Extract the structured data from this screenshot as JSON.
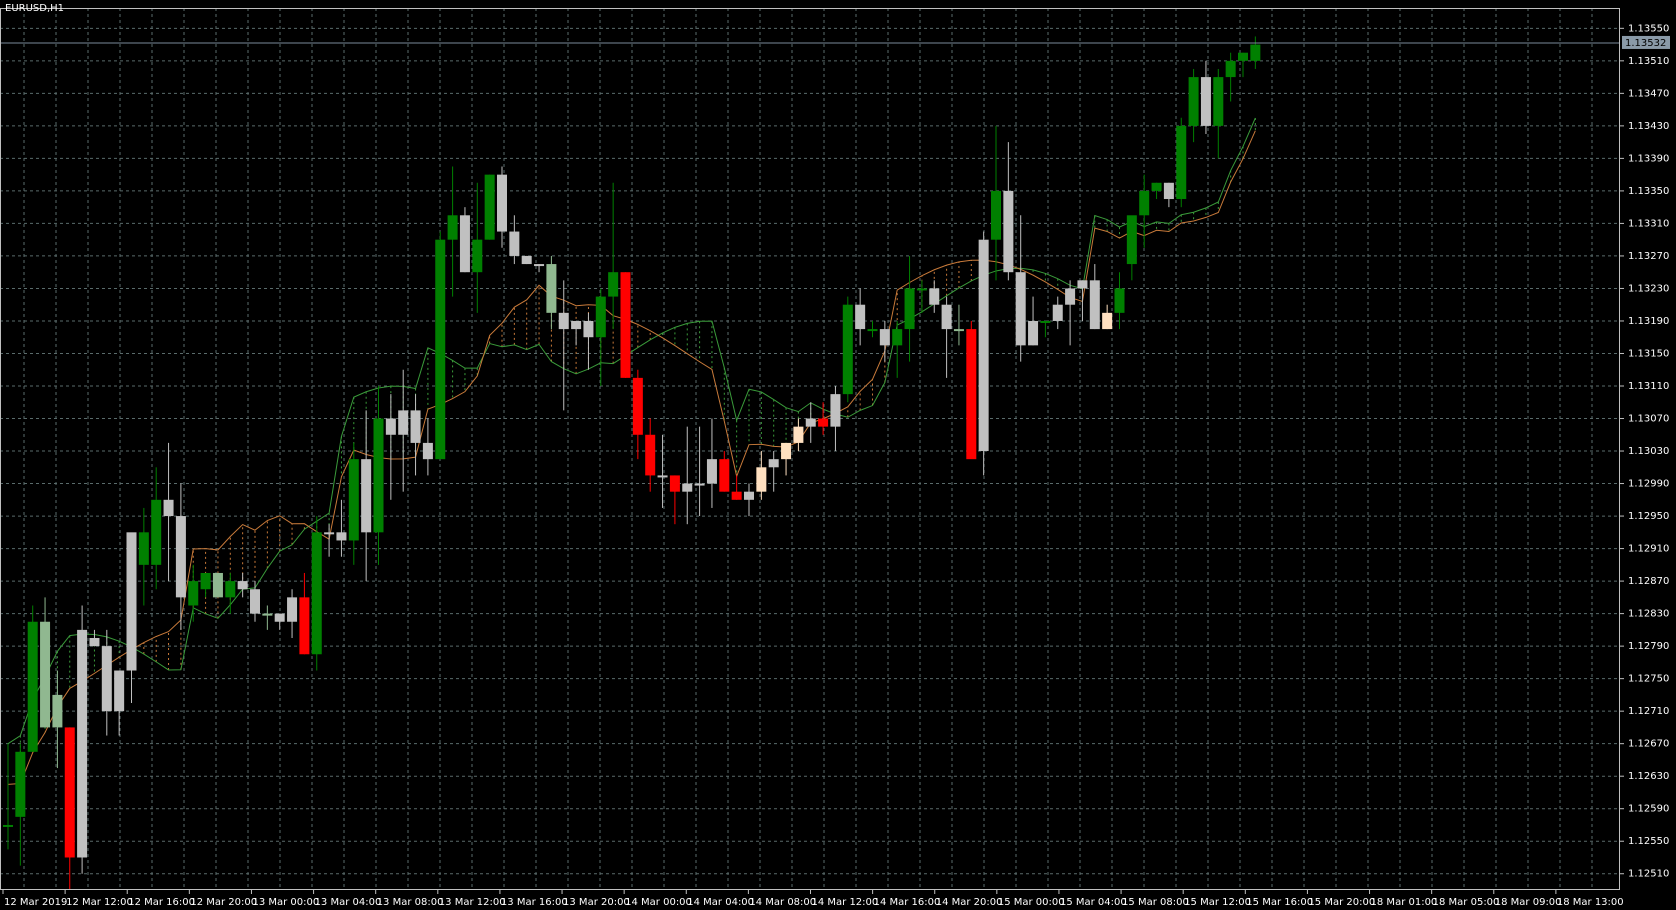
{
  "header": {
    "symbol": "EURUSD,H1"
  },
  "current_price_label": "1.13532",
  "colors": {
    "background": "#000000",
    "grid": "#5a6b6b",
    "axis": "#c0c0c0",
    "text": "#ffffff",
    "bull_candle": "#008000",
    "bear_candle": "#c0c0c0",
    "bull_alt": "#90b890",
    "bear_alt": "#ff0000",
    "doji": "#ffe0c0",
    "cloud_up": "#3a9b3a",
    "cloud_down": "#c87a3a",
    "tenkan": "#c8c8a0",
    "kijun": "#e8c090",
    "price_line": "#7a8a9a"
  },
  "chart_data": {
    "type": "candlestick",
    "title": "EURUSD,H1",
    "ylim": [
      1.1249,
      1.13575
    ],
    "y_ticks": [
      "1.13550",
      "1.13510",
      "1.13470",
      "1.13430",
      "1.13390",
      "1.13350",
      "1.13310",
      "1.13270",
      "1.13230",
      "1.13190",
      "1.13150",
      "1.13110",
      "1.13070",
      "1.13030",
      "1.12990",
      "1.12950",
      "1.12910",
      "1.12870",
      "1.12830",
      "1.12790",
      "1.12750",
      "1.12710",
      "1.12670",
      "1.12630",
      "1.12590",
      "1.12550",
      "1.12510"
    ],
    "x_labels": [
      "12 Mar 2019",
      "12 Mar 12:00",
      "12 Mar 16:00",
      "12 Mar 20:00",
      "13 Mar 00:00",
      "13 Mar 04:00",
      "13 Mar 08:00",
      "13 Mar 12:00",
      "13 Mar 16:00",
      "13 Mar 20:00",
      "14 Mar 00:00",
      "14 Mar 04:00",
      "14 Mar 08:00",
      "14 Mar 12:00",
      "14 Mar 16:00",
      "14 Mar 20:00",
      "15 Mar 00:00",
      "15 Mar 04:00",
      "15 Mar 08:00",
      "15 Mar 12:00",
      "15 Mar 16:00",
      "15 Mar 20:00",
      "18 Mar 01:00",
      "18 Mar 05:00",
      "18 Mar 09:00",
      "18 Mar 13:00"
    ],
    "candles": [
      {
        "o": 1.1257,
        "h": 1.1267,
        "l": 1.1254,
        "c": 1.1257,
        "k": "up"
      },
      {
        "o": 1.1258,
        "h": 1.1267,
        "l": 1.1252,
        "c": 1.1266,
        "k": "up"
      },
      {
        "o": 1.1266,
        "h": 1.1284,
        "l": 1.1266,
        "c": 1.1282,
        "k": "up"
      },
      {
        "o": 1.1282,
        "h": 1.1285,
        "l": 1.1269,
        "c": 1.1269,
        "k": "alt"
      },
      {
        "o": 1.1269,
        "h": 1.1276,
        "l": 1.1264,
        "c": 1.1273,
        "k": "alt"
      },
      {
        "o": 1.1269,
        "h": 1.1269,
        "l": 1.1249,
        "c": 1.1253,
        "k": "red"
      },
      {
        "o": 1.1253,
        "h": 1.1284,
        "l": 1.1251,
        "c": 1.1281,
        "k": "gray"
      },
      {
        "o": 1.1279,
        "h": 1.1281,
        "l": 1.1279,
        "c": 1.128,
        "k": "gray"
      },
      {
        "o": 1.1279,
        "h": 1.1281,
        "l": 1.1268,
        "c": 1.1271,
        "k": "gray"
      },
      {
        "o": 1.1271,
        "h": 1.1276,
        "l": 1.1268,
        "c": 1.1276,
        "k": "gray"
      },
      {
        "o": 1.1276,
        "h": 1.1292,
        "l": 1.1272,
        "c": 1.1293,
        "k": "gray"
      },
      {
        "o": 1.1293,
        "h": 1.1296,
        "l": 1.1284,
        "c": 1.1289,
        "k": "up"
      },
      {
        "o": 1.1289,
        "h": 1.1301,
        "l": 1.1286,
        "c": 1.1297,
        "k": "up"
      },
      {
        "o": 1.1297,
        "h": 1.1304,
        "l": 1.1287,
        "c": 1.1295,
        "k": "gray"
      },
      {
        "o": 1.1295,
        "h": 1.1299,
        "l": 1.1281,
        "c": 1.1285,
        "k": "gray"
      },
      {
        "o": 1.1287,
        "h": 1.1289,
        "l": 1.1282,
        "c": 1.1284,
        "k": "up"
      },
      {
        "o": 1.1286,
        "h": 1.1288,
        "l": 1.1285,
        "c": 1.1288,
        "k": "up"
      },
      {
        "o": 1.1288,
        "h": 1.1288,
        "l": 1.1285,
        "c": 1.1285,
        "k": "alt"
      },
      {
        "o": 1.1285,
        "h": 1.1288,
        "l": 1.1283,
        "c": 1.1287,
        "k": "up"
      },
      {
        "o": 1.1287,
        "h": 1.1288,
        "l": 1.1285,
        "c": 1.1286,
        "k": "gray"
      },
      {
        "o": 1.1286,
        "h": 1.1287,
        "l": 1.1282,
        "c": 1.1283,
        "k": "gray"
      },
      {
        "o": 1.1283,
        "h": 1.1284,
        "l": 1.1281,
        "c": 1.1283,
        "k": "alt"
      },
      {
        "o": 1.1283,
        "h": 1.1283,
        "l": 1.1281,
        "c": 1.1282,
        "k": "gray"
      },
      {
        "o": 1.1282,
        "h": 1.1286,
        "l": 1.128,
        "c": 1.1285,
        "k": "gray"
      },
      {
        "o": 1.1285,
        "h": 1.1288,
        "l": 1.1278,
        "c": 1.1278,
        "k": "red"
      },
      {
        "o": 1.1278,
        "h": 1.1295,
        "l": 1.1276,
        "c": 1.1293,
        "k": "up"
      },
      {
        "o": 1.1293,
        "h": 1.1294,
        "l": 1.129,
        "c": 1.1293,
        "k": "gray"
      },
      {
        "o": 1.1293,
        "h": 1.1297,
        "l": 1.129,
        "c": 1.1292,
        "k": "gray"
      },
      {
        "o": 1.1292,
        "h": 1.1304,
        "l": 1.1289,
        "c": 1.1302,
        "k": "up"
      },
      {
        "o": 1.1302,
        "h": 1.1308,
        "l": 1.1287,
        "c": 1.1293,
        "k": "gray"
      },
      {
        "o": 1.1293,
        "h": 1.1311,
        "l": 1.1289,
        "c": 1.1307,
        "k": "up"
      },
      {
        "o": 1.1307,
        "h": 1.131,
        "l": 1.1297,
        "c": 1.1305,
        "k": "gray"
      },
      {
        "o": 1.1305,
        "h": 1.1313,
        "l": 1.1298,
        "c": 1.1308,
        "k": "gray"
      },
      {
        "o": 1.1308,
        "h": 1.131,
        "l": 1.13,
        "c": 1.1304,
        "k": "gray"
      },
      {
        "o": 1.1304,
        "h": 1.1307,
        "l": 1.13,
        "c": 1.1302,
        "k": "gray"
      },
      {
        "o": 1.1302,
        "h": 1.133,
        "l": 1.1302,
        "c": 1.1329,
        "k": "up"
      },
      {
        "o": 1.1329,
        "h": 1.1338,
        "l": 1.1322,
        "c": 1.1332,
        "k": "up"
      },
      {
        "o": 1.1332,
        "h": 1.1333,
        "l": 1.1325,
        "c": 1.1325,
        "k": "gray"
      },
      {
        "o": 1.1325,
        "h": 1.1336,
        "l": 1.132,
        "c": 1.1329,
        "k": "up"
      },
      {
        "o": 1.1329,
        "h": 1.1337,
        "l": 1.1329,
        "c": 1.1337,
        "k": "up"
      },
      {
        "o": 1.1337,
        "h": 1.1338,
        "l": 1.1328,
        "c": 1.133,
        "k": "gray"
      },
      {
        "o": 1.133,
        "h": 1.1332,
        "l": 1.1326,
        "c": 1.1327,
        "k": "gray"
      },
      {
        "o": 1.1327,
        "h": 1.1327,
        "l": 1.1326,
        "c": 1.1326,
        "k": "gray"
      },
      {
        "o": 1.1326,
        "h": 1.1326,
        "l": 1.1325,
        "c": 1.1326,
        "k": "gray"
      },
      {
        "o": 1.1326,
        "h": 1.1327,
        "l": 1.1318,
        "c": 1.132,
        "k": "alt"
      },
      {
        "o": 1.132,
        "h": 1.1324,
        "l": 1.1308,
        "c": 1.1318,
        "k": "gray"
      },
      {
        "o": 1.1318,
        "h": 1.1319,
        "l": 1.1316,
        "c": 1.1319,
        "k": "gray"
      },
      {
        "o": 1.1319,
        "h": 1.132,
        "l": 1.1313,
        "c": 1.1317,
        "k": "gray"
      },
      {
        "o": 1.1317,
        "h": 1.1323,
        "l": 1.1311,
        "c": 1.1322,
        "k": "up"
      },
      {
        "o": 1.1322,
        "h": 1.1336,
        "l": 1.1318,
        "c": 1.1325,
        "k": "up"
      },
      {
        "o": 1.1325,
        "h": 1.1325,
        "l": 1.1312,
        "c": 1.1312,
        "k": "red"
      },
      {
        "o": 1.1312,
        "h": 1.1313,
        "l": 1.1302,
        "c": 1.1305,
        "k": "red"
      },
      {
        "o": 1.1305,
        "h": 1.1307,
        "l": 1.1298,
        "c": 1.13,
        "k": "red"
      },
      {
        "o": 1.13,
        "h": 1.1305,
        "l": 1.1296,
        "c": 1.13,
        "k": "gray"
      },
      {
        "o": 1.13,
        "h": 1.13,
        "l": 1.1294,
        "c": 1.1298,
        "k": "red"
      },
      {
        "o": 1.1298,
        "h": 1.1306,
        "l": 1.1294,
        "c": 1.1299,
        "k": "gray"
      },
      {
        "o": 1.1299,
        "h": 1.1306,
        "l": 1.1295,
        "c": 1.1299,
        "k": "gray"
      },
      {
        "o": 1.1299,
        "h": 1.1307,
        "l": 1.1296,
        "c": 1.1302,
        "k": "gray"
      },
      {
        "o": 1.1302,
        "h": 1.1303,
        "l": 1.1298,
        "c": 1.1298,
        "k": "red"
      },
      {
        "o": 1.1298,
        "h": 1.13,
        "l": 1.1297,
        "c": 1.1297,
        "k": "red"
      },
      {
        "o": 1.1297,
        "h": 1.1299,
        "l": 1.1295,
        "c": 1.1298,
        "k": "gray"
      },
      {
        "o": 1.1298,
        "h": 1.1303,
        "l": 1.1297,
        "c": 1.1301,
        "k": "doji"
      },
      {
        "o": 1.1301,
        "h": 1.1303,
        "l": 1.1298,
        "c": 1.1302,
        "k": "gray"
      },
      {
        "o": 1.1302,
        "h": 1.1304,
        "l": 1.13,
        "c": 1.1304,
        "k": "doji"
      },
      {
        "o": 1.1304,
        "h": 1.1307,
        "l": 1.1303,
        "c": 1.1306,
        "k": "doji"
      },
      {
        "o": 1.1306,
        "h": 1.1309,
        "l": 1.1304,
        "c": 1.1307,
        "k": "gray"
      },
      {
        "o": 1.1307,
        "h": 1.1309,
        "l": 1.1305,
        "c": 1.1306,
        "k": "red"
      },
      {
        "o": 1.1306,
        "h": 1.1311,
        "l": 1.1303,
        "c": 1.131,
        "k": "gray"
      },
      {
        "o": 1.131,
        "h": 1.1322,
        "l": 1.1309,
        "c": 1.1321,
        "k": "up"
      },
      {
        "o": 1.1321,
        "h": 1.1323,
        "l": 1.1316,
        "c": 1.1318,
        "k": "gray"
      },
      {
        "o": 1.1318,
        "h": 1.1319,
        "l": 1.1317,
        "c": 1.1318,
        "k": "up"
      },
      {
        "o": 1.1318,
        "h": 1.1319,
        "l": 1.1314,
        "c": 1.1316,
        "k": "gray"
      },
      {
        "o": 1.1316,
        "h": 1.1319,
        "l": 1.1312,
        "c": 1.1318,
        "k": "up"
      },
      {
        "o": 1.1318,
        "h": 1.1327,
        "l": 1.1314,
        "c": 1.1323,
        "k": "up"
      },
      {
        "o": 1.1323,
        "h": 1.1324,
        "l": 1.132,
        "c": 1.1323,
        "k": "up"
      },
      {
        "o": 1.1323,
        "h": 1.1324,
        "l": 1.132,
        "c": 1.1321,
        "k": "gray"
      },
      {
        "o": 1.1321,
        "h": 1.1322,
        "l": 1.1312,
        "c": 1.1318,
        "k": "gray"
      },
      {
        "o": 1.1318,
        "h": 1.1321,
        "l": 1.1316,
        "c": 1.1318,
        "k": "alt"
      },
      {
        "o": 1.1318,
        "h": 1.1319,
        "l": 1.1304,
        "c": 1.1302,
        "k": "red"
      },
      {
        "o": 1.1303,
        "h": 1.133,
        "l": 1.13,
        "c": 1.1329,
        "k": "gray"
      },
      {
        "o": 1.1329,
        "h": 1.1343,
        "l": 1.1324,
        "c": 1.1335,
        "k": "up"
      },
      {
        "o": 1.1335,
        "h": 1.1341,
        "l": 1.1324,
        "c": 1.1325,
        "k": "gray"
      },
      {
        "o": 1.1325,
        "h": 1.1332,
        "l": 1.1314,
        "c": 1.1316,
        "k": "gray"
      },
      {
        "o": 1.1316,
        "h": 1.1322,
        "l": 1.1316,
        "c": 1.1319,
        "k": "gray"
      },
      {
        "o": 1.1319,
        "h": 1.1319,
        "l": 1.1317,
        "c": 1.1319,
        "k": "up"
      },
      {
        "o": 1.1319,
        "h": 1.1322,
        "l": 1.1318,
        "c": 1.1321,
        "k": "gray"
      },
      {
        "o": 1.1321,
        "h": 1.1324,
        "l": 1.1316,
        "c": 1.1323,
        "k": "gray"
      },
      {
        "o": 1.1323,
        "h": 1.1324,
        "l": 1.1319,
        "c": 1.1324,
        "k": "gray"
      },
      {
        "o": 1.1324,
        "h": 1.1326,
        "l": 1.1318,
        "c": 1.1318,
        "k": "gray"
      },
      {
        "o": 1.1318,
        "h": 1.1321,
        "l": 1.1318,
        "c": 1.132,
        "k": "doji"
      },
      {
        "o": 1.132,
        "h": 1.1325,
        "l": 1.1318,
        "c": 1.1323,
        "k": "up"
      },
      {
        "o": 1.1326,
        "h": 1.1331,
        "l": 1.1324,
        "c": 1.1332,
        "k": "up"
      },
      {
        "o": 1.1332,
        "h": 1.1337,
        "l": 1.1328,
        "c": 1.1335,
        "k": "up"
      },
      {
        "o": 1.1335,
        "h": 1.1336,
        "l": 1.1334,
        "c": 1.1336,
        "k": "up"
      },
      {
        "o": 1.1336,
        "h": 1.1336,
        "l": 1.1333,
        "c": 1.1334,
        "k": "gray"
      },
      {
        "o": 1.1334,
        "h": 1.1344,
        "l": 1.1333,
        "c": 1.1343,
        "k": "up"
      },
      {
        "o": 1.1343,
        "h": 1.135,
        "l": 1.1341,
        "c": 1.1349,
        "k": "up"
      },
      {
        "o": 1.1349,
        "h": 1.1351,
        "l": 1.1342,
        "c": 1.1343,
        "k": "gray"
      },
      {
        "o": 1.1343,
        "h": 1.135,
        "l": 1.1339,
        "c": 1.1349,
        "k": "up"
      },
      {
        "o": 1.1349,
        "h": 1.1352,
        "l": 1.1346,
        "c": 1.1351,
        "k": "up"
      },
      {
        "o": 1.1351,
        "h": 1.1352,
        "l": 1.1349,
        "c": 1.1352,
        "k": "up"
      },
      {
        "o": 1.1351,
        "h": 1.1354,
        "l": 1.135,
        "c": 1.1353,
        "k": "up"
      }
    ]
  }
}
